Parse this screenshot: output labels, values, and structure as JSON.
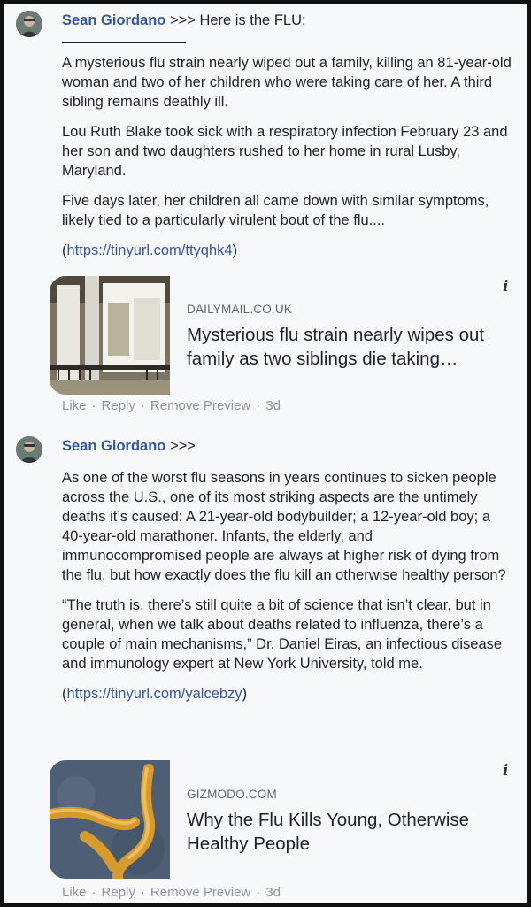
{
  "comments": [
    {
      "author": "Sean Giordano",
      "prefix": ">>> Here is the FLU:",
      "paragraphs": [
        "A mysterious flu strain nearly wiped out a family, killing an 81-year-old woman and two of her children who were taking care of her. A third sibling remains deathly ill.",
        "Lou Ruth Blake took sick with a respiratory infection February 23 and her son and two daughters rushed to her home in rural Lusby, Maryland.",
        "Five days later, her children all came down with similar symptoms, likely tied to a particularly virulent bout of the flu...."
      ],
      "link": "https://tinyurl.com/ttyqhk4",
      "preview": {
        "domain": "DAILYMAIL.CO.UK",
        "title": "Mysterious flu strain nearly wipes out family as two siblings die taking…",
        "info_glyph": "i"
      },
      "actions": {
        "like": "Like",
        "reply": "Reply",
        "remove": "Remove Preview",
        "time": "3d"
      }
    },
    {
      "author": "Sean Giordano",
      "prefix": ">>>",
      "paragraphs": [
        "As one of the worst flu seasons in years continues to sicken people across the U.S., one of its most striking aspects are the untimely deaths it’s caused: A 21-year-old bodybuilder; a 12-year-old boy; a 40-year-old marathoner. Infants, the elderly, and immunocompromised people are always at higher risk of dying from the flu, but how exactly does the flu kill an otherwise healthy person?",
        "“The truth is, there’s still quite a bit of science that isn’t clear, but in general, when we talk about deaths related to influenza, there’s a couple of main mechanisms,” Dr. Daniel Eiras, an infectious disease and immunology expert at New York University, told me."
      ],
      "link": "https://tinyurl.com/yalcebzy",
      "preview": {
        "domain": "GIZMODO.COM",
        "title": "Why the Flu Kills Young, Otherwise Healthy People",
        "info_glyph": "i"
      },
      "actions": {
        "like": "Like",
        "reply": "Reply",
        "remove": "Remove Preview",
        "time": "3d"
      }
    }
  ],
  "colors": {
    "author": "#365899",
    "link": "#365899",
    "meta": "#90949c",
    "domain": "#606770"
  },
  "icons": {
    "info": "info-icon",
    "avatar": "profile-photo"
  }
}
